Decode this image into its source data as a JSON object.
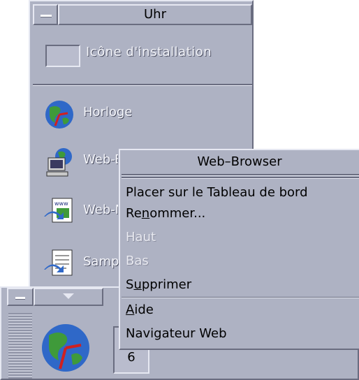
{
  "subpanel": {
    "title": "Uhr",
    "install_label": "Icône d'installation",
    "items": [
      {
        "label": "Horloge",
        "icon": "globe-clock-icon"
      },
      {
        "label": "Web-Browser",
        "icon": "web-browser-computer-icon"
      },
      {
        "label": "Web-Navigateur",
        "icon": "www-document-icon"
      },
      {
        "label": "Sample",
        "icon": "sample-document-icon"
      }
    ]
  },
  "front_panel": {
    "date_day": "6"
  },
  "menu": {
    "title": "Web–Browser",
    "items": [
      {
        "label": "Placer sur le Tableau de bord",
        "enabled": true
      },
      {
        "label_pre": "Re",
        "label_u": "n",
        "label_post": "ommer...",
        "enabled": true
      },
      {
        "label": "Haut",
        "enabled": false
      },
      {
        "label": "Bas",
        "enabled": false
      },
      {
        "label_pre": "S",
        "label_u": "u",
        "label_post": "pprimer",
        "enabled": true
      },
      {
        "label_u": "A",
        "label_post": "ide",
        "enabled": true
      },
      {
        "label": "Navigateur Web",
        "enabled": true
      }
    ]
  },
  "colors": {
    "panel_bg": "#aeb2c3",
    "highlight": "#e6e8f2",
    "shadow": "#6a6d80"
  }
}
